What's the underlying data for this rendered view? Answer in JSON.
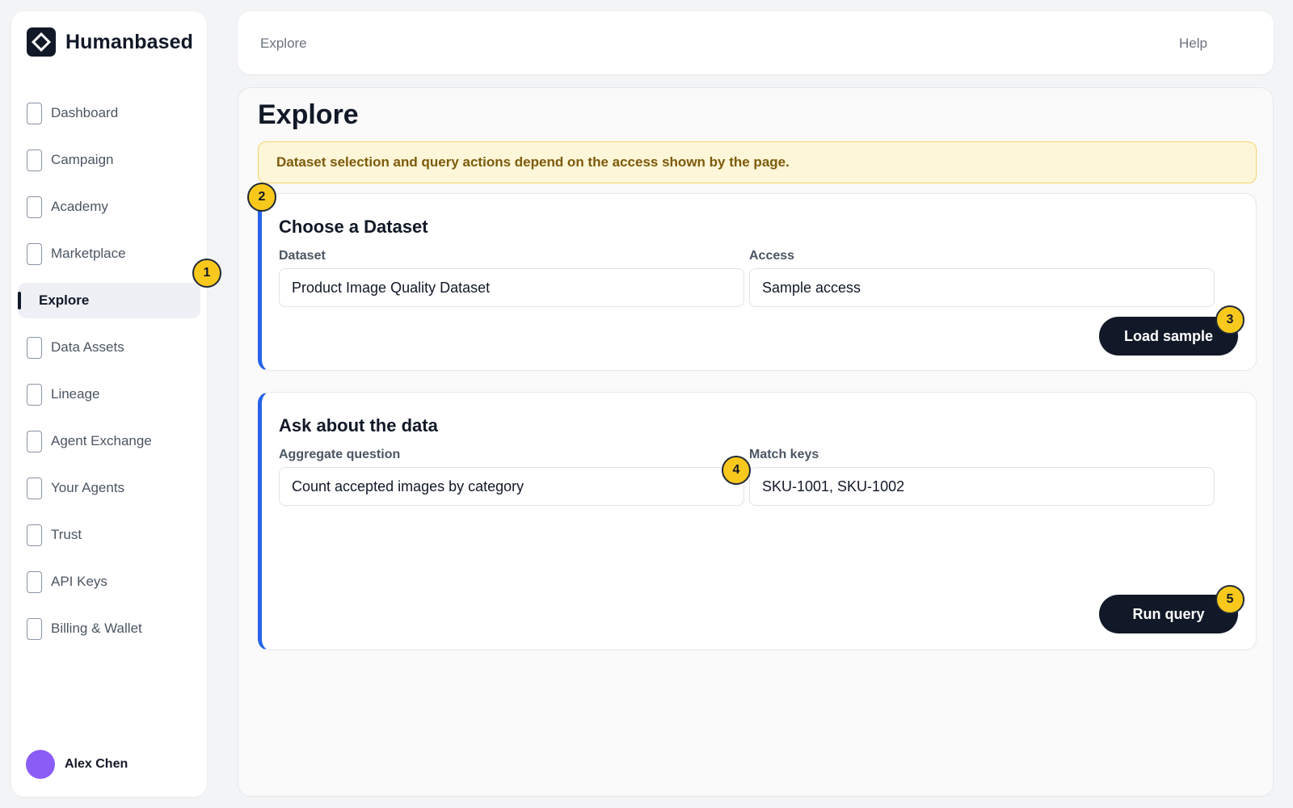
{
  "app": {
    "brand": "Humanbased"
  },
  "sidebar": {
    "items": [
      {
        "label": "Dashboard"
      },
      {
        "label": "Campaign"
      },
      {
        "label": "Academy"
      },
      {
        "label": "Marketplace"
      },
      {
        "label": "Explore",
        "active": true
      },
      {
        "label": "Data Assets"
      },
      {
        "label": "Lineage"
      },
      {
        "label": "Agent Exchange"
      },
      {
        "label": "Your Agents"
      },
      {
        "label": "Trust"
      },
      {
        "label": "API Keys"
      },
      {
        "label": "Billing & Wallet"
      }
    ],
    "user": {
      "name": "Alex Chen",
      "avatar_color": "#8b5cf6"
    }
  },
  "topbar": {
    "breadcrumb": "Explore",
    "help": "Help"
  },
  "main": {
    "title": "Explore",
    "notice": "Dataset selection and query actions depend on the access shown by the page.",
    "dataset_card": {
      "title": "Choose a Dataset",
      "dataset_label": "Dataset",
      "dataset_value": "Product Image Quality Dataset",
      "access_label": "Access",
      "access_value": "Sample access",
      "button": "Load sample"
    },
    "query_card": {
      "title": "Ask about the data",
      "question_label": "Aggregate question",
      "question_value": "Count accepted images by category",
      "keys_label": "Match keys",
      "keys_value": "SKU-1001, SKU-1002",
      "button": "Run query"
    }
  },
  "badges": {
    "b1": "1",
    "b2": "2",
    "b3": "3",
    "b4": "4",
    "b5": "5"
  },
  "colors": {
    "accent": "#2563eb",
    "badge": "#f8c81c",
    "notice_bg": "#fef6d8",
    "button": "#111827"
  }
}
